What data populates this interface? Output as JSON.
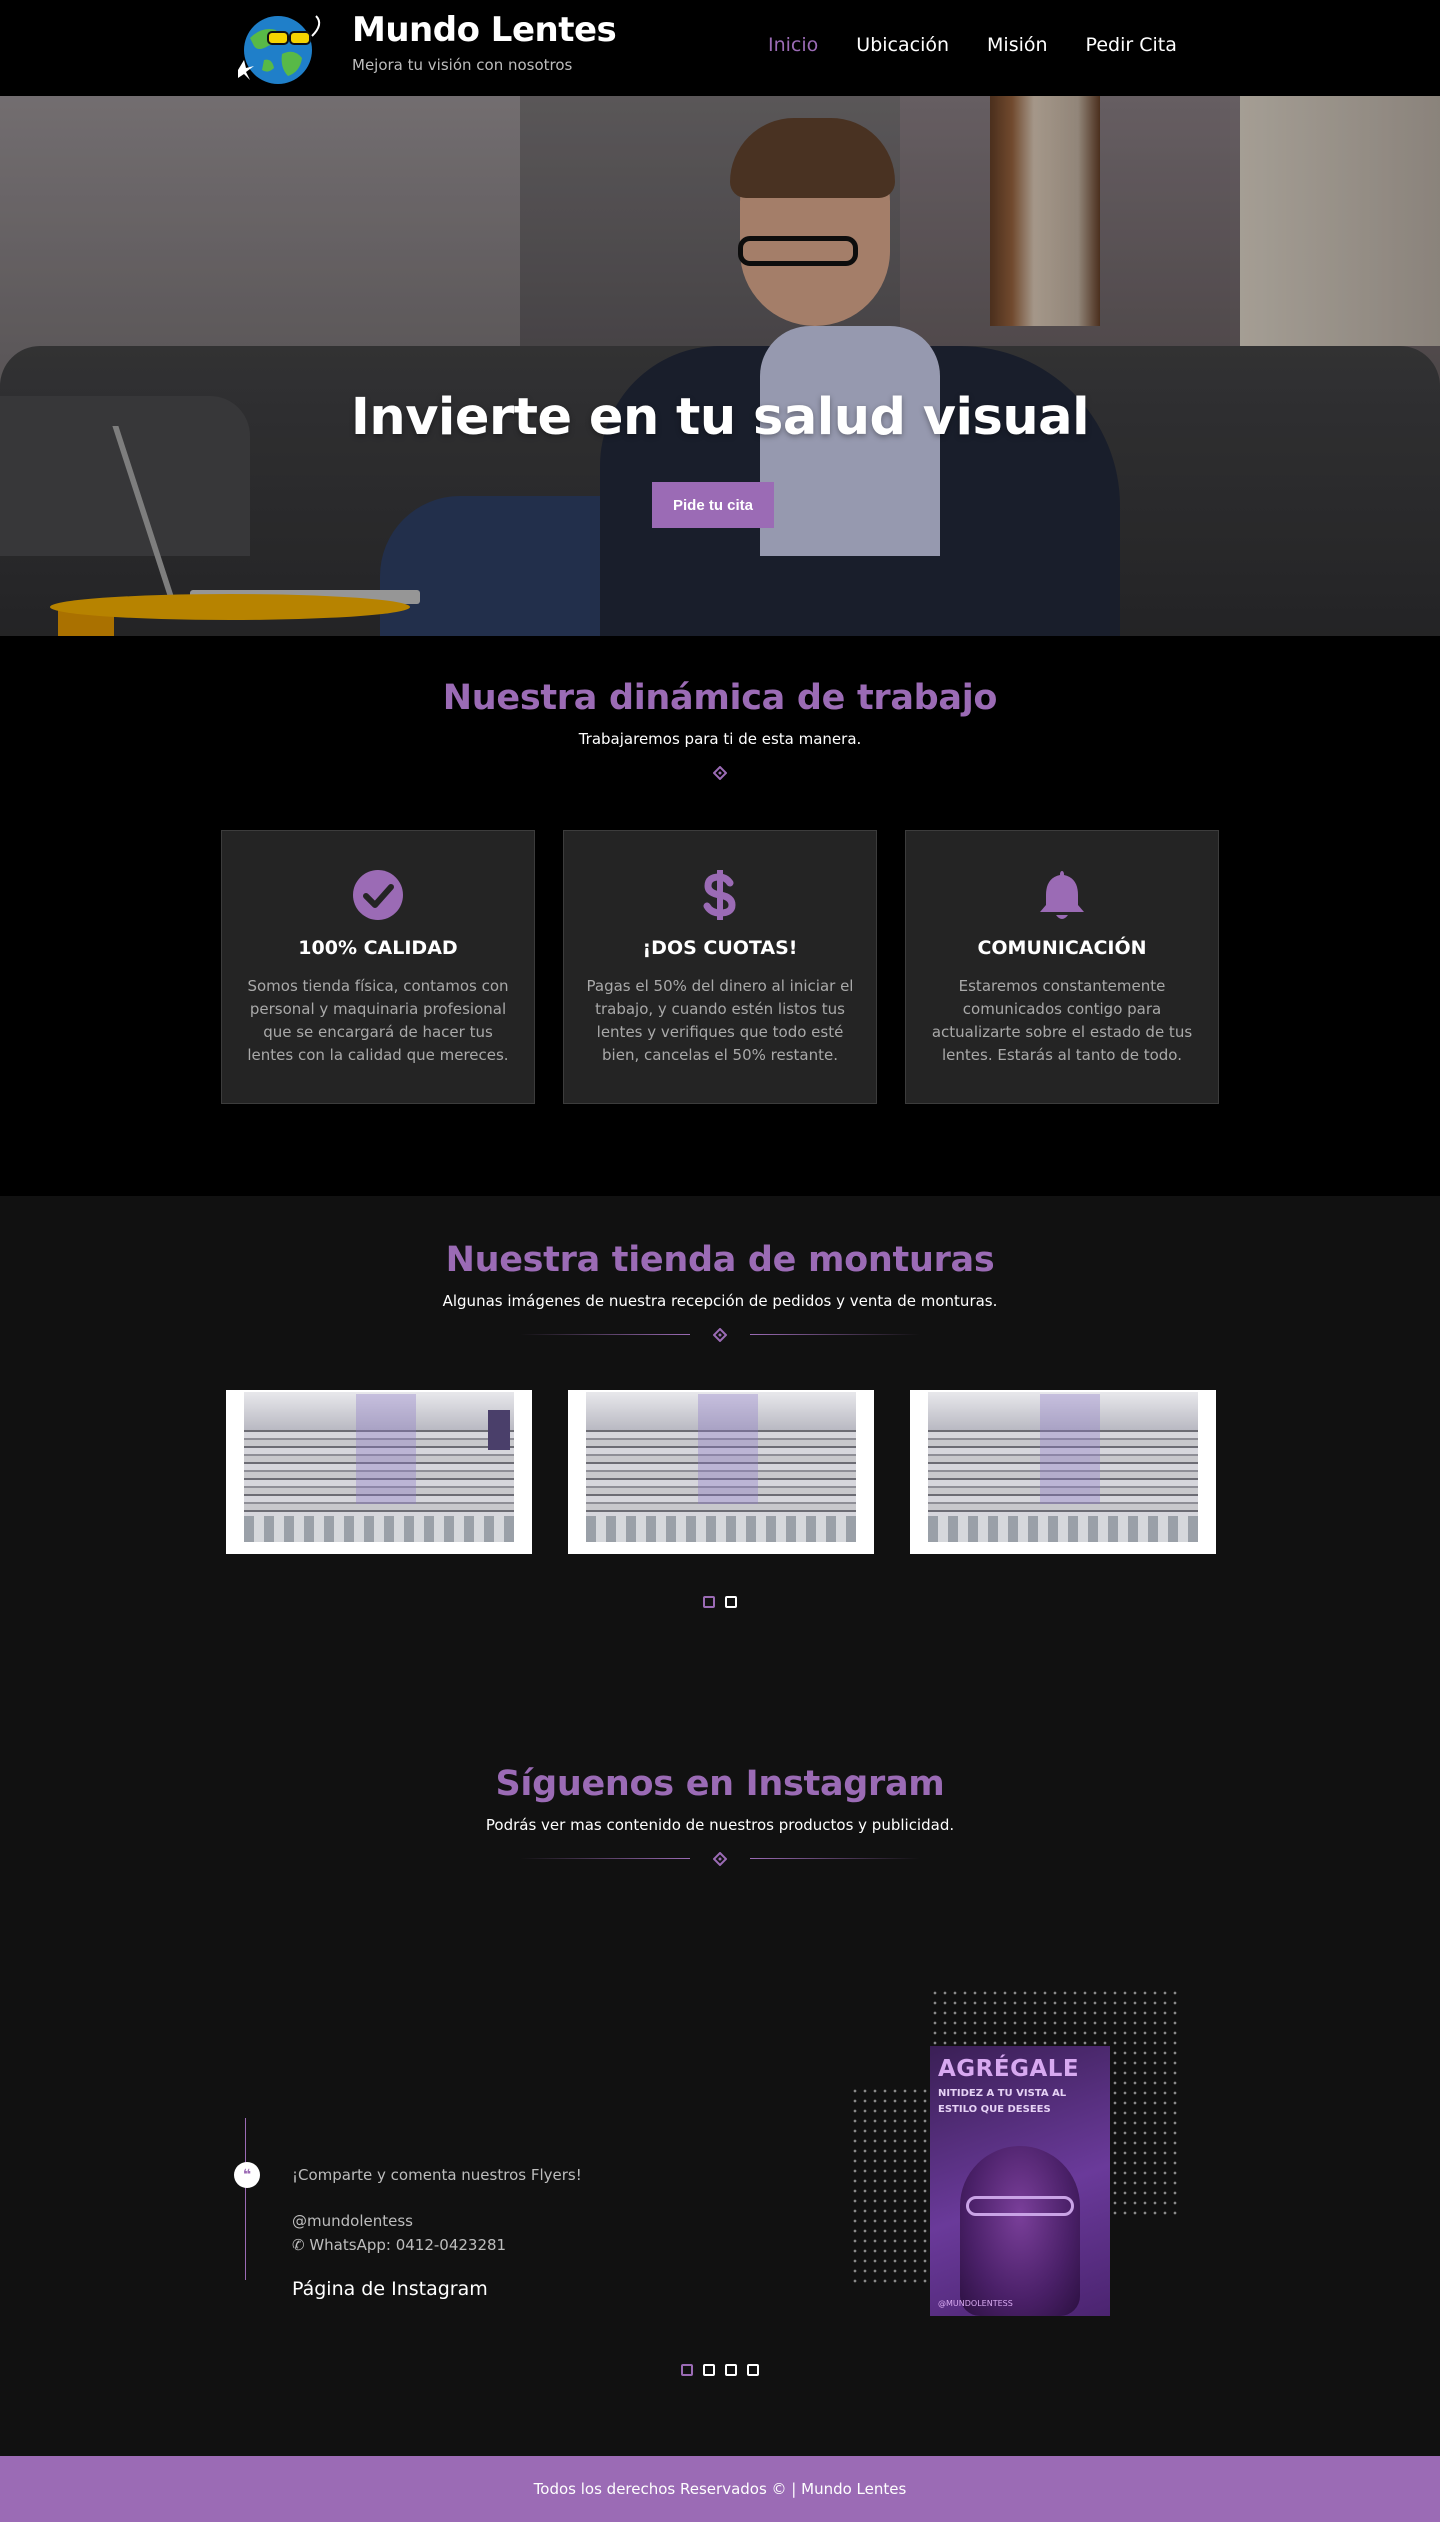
{
  "header": {
    "brand_title": "Mundo Lentes",
    "brand_tagline": "Mejora tu visión con nosotros",
    "nav": [
      {
        "label": "Inicio",
        "active": true
      },
      {
        "label": "Ubicación",
        "active": false
      },
      {
        "label": "Misión",
        "active": false
      },
      {
        "label": "Pedir Cita",
        "active": false
      }
    ]
  },
  "hero": {
    "title": "Invierte en tu salud visual",
    "button_label": "Pide tu cita"
  },
  "dinamica": {
    "title": "Nuestra dinámica de trabajo",
    "subtitle": "Trabajaremos para ti de esta manera.",
    "cards": [
      {
        "icon": "check-circle-icon",
        "title": "100% CALIDAD",
        "text": "Somos tienda física, contamos con personal y maquinaria profesional que se encargará de hacer tus lentes con la calidad que mereces."
      },
      {
        "icon": "dollar-icon",
        "title": "¡DOS CUOTAS!",
        "text": "Pagas el 50% del dinero al iniciar el trabajo, y cuando estén listos tus lentes y verifiques que todo esté bien, cancelas el 50% restante."
      },
      {
        "icon": "bell-icon",
        "title": "COMUNICACIÓN",
        "text": "Estaremos constantemente comunicados contigo para actualizarte sobre el estado de tus lentes. Estarás al tanto de todo."
      }
    ]
  },
  "tienda": {
    "title": "Nuestra tienda de monturas",
    "subtitle": "Algunas imágenes de nuestra recepción de pedidos y venta de monturas.",
    "slides": 2,
    "active_slide": 1
  },
  "instagram": {
    "title": "Síguenos en Instagram",
    "subtitle": "Podrás ver mas contenido de nuestros productos y publicidad.",
    "text1": "¡Comparte y comenta nuestros Flyers!",
    "handle": "@mundolentess",
    "whatsapp": "WhatsApp: 0412-0423281",
    "link_label": "Página de Instagram",
    "flyer": {
      "title": "AGRÉGALE",
      "subtitle": "NITIDEZ A TU VISTA AL ESTILO QUE DESEES",
      "footer": "@MUNDOLENTESS"
    },
    "slides": 4,
    "active_slide": 1
  },
  "footer": {
    "text": "Todos los derechos Reservados © | Mundo Lentes"
  },
  "colors": {
    "accent": "#9b6bb5",
    "page_bg": "#000000",
    "section_bg": "#111111",
    "card_bg": "#242424"
  }
}
